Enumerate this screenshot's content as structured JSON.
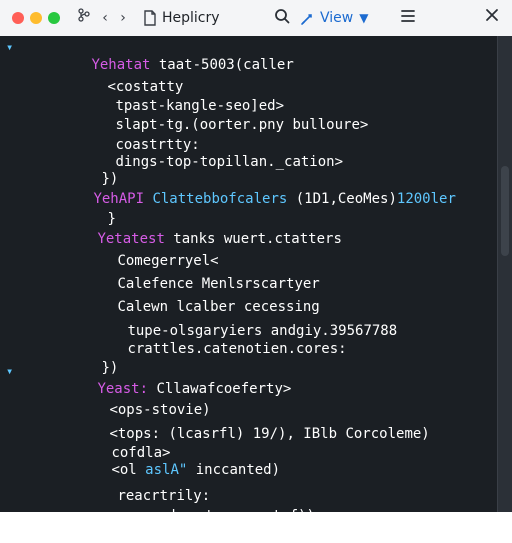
{
  "window": {
    "title": "Heplicry",
    "view_label": "View",
    "icons": {
      "branch": "branch-icon",
      "back": "chevron-left-icon",
      "forward": "chevron-right-icon",
      "file": "document-icon",
      "search": "search-icon",
      "view": "view-icon",
      "menu": "hamburger-menu-icon",
      "close": "close-icon"
    },
    "colors": {
      "topbar_bg": "#f4f5f7",
      "editor_bg": "#1b1f24",
      "accent_blue": "#1c6bd0",
      "keyword_magenta": "#d65ce6",
      "string_cyan": "#5ec7ff"
    }
  },
  "code": {
    "lines": [
      {
        "gutter": "▾",
        "segments": [
          {
            "text": "Yehatat",
            "cls": "kw"
          },
          {
            "text": " taat-5003(caller",
            "cls": "white"
          }
        ]
      },
      {
        "segments": [
          {
            "text": "<costatty",
            "cls": "white"
          }
        ]
      },
      {
        "segments": [
          {
            "text": "tpast-kangle-seo]ed>",
            "cls": "white"
          }
        ]
      },
      {
        "segments": [
          {
            "text": "slapt-tg.(oorter.pny bulloure>",
            "cls": "white"
          }
        ]
      },
      {
        "segments": [
          {
            "text": "coastrtty:",
            "cls": "white"
          }
        ]
      },
      {
        "segments": [
          {
            "text": "dings-top-topillan._cation>",
            "cls": "white"
          }
        ]
      },
      {
        "segments": [
          {
            "text": "})",
            "cls": "white"
          }
        ]
      },
      {
        "segments": [
          {
            "text": "YehAPI",
            "cls": "kw"
          },
          {
            "text": " Clattebbofcalers ",
            "cls": "cyan"
          },
          {
            "text": "(1D1,CeoMes)",
            "cls": "white"
          },
          {
            "text": "1200ler",
            "cls": "cyan"
          }
        ]
      },
      {
        "segments": [
          {
            "text": "}",
            "cls": "white"
          }
        ]
      },
      {
        "segments": [
          {
            "text": "Yetatest",
            "cls": "kw"
          },
          {
            "text": " tanks wuert.ctatters",
            "cls": "white"
          }
        ]
      },
      {
        "segments": [
          {
            "text": "Comegerryel<",
            "cls": "white"
          }
        ]
      },
      {
        "segments": [
          {
            "text": "Calefence Menlsrscartyer",
            "cls": "white"
          }
        ]
      },
      {
        "segments": [
          {
            "text": "Calewn lcalber cecessing",
            "cls": "white"
          }
        ]
      },
      {
        "segments": [
          {
            "text": "tupe-olsgaryiers andgiy.39567788",
            "cls": "white"
          }
        ]
      },
      {
        "segments": [
          {
            "text": "crattles.catenotien.cores:",
            "cls": "white"
          }
        ]
      },
      {
        "segments": [
          {
            "text": "})",
            "cls": "white"
          }
        ]
      },
      {
        "gutter": "▾",
        "segments": [
          {
            "text": "Yeast:",
            "cls": "kw"
          },
          {
            "text": " Cllawafcoeferty>",
            "cls": "white"
          }
        ]
      },
      {
        "segments": [
          {
            "text": "<ops-stovie)",
            "cls": "white"
          }
        ]
      },
      {
        "segments": [
          {
            "text": "<tops: (lcasrfl) 19/), IBlb Corcoleme)",
            "cls": "white"
          }
        ]
      },
      {
        "segments": [
          {
            "text": "cofdla>",
            "cls": "white"
          }
        ]
      },
      {
        "segments": [
          {
            "text": "<ol",
            "cls": "white"
          },
          {
            "text": " aslA\"",
            "cls": "cyan"
          },
          {
            "text": " inccanted)",
            "cls": "white"
          }
        ]
      },
      {
        "segments": [
          {
            "text": "reacrtrily:",
            "cls": "white"
          }
        ]
      },
      {
        "segments": [
          {
            "text": "presuber tewragratef))",
            "cls": "white"
          }
        ]
      }
    ]
  }
}
